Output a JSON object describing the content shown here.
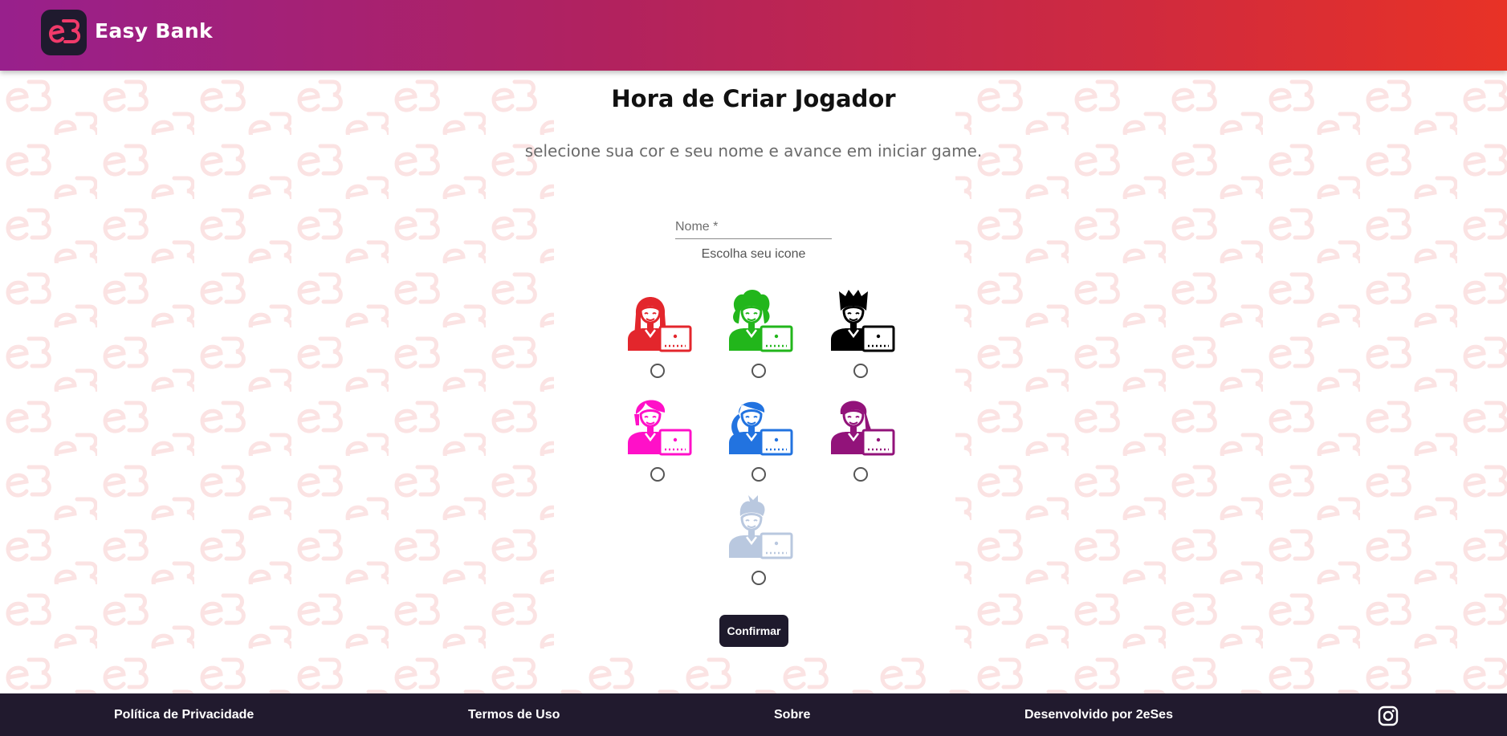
{
  "header": {
    "brand": "Easy Bank",
    "logo_icon": "easy-bank-logo"
  },
  "main": {
    "title": "Hora de Criar Jogador",
    "subtitle": "selecione sua cor e seu nome e avance em iniciar game.",
    "name_placeholder": "Nome *",
    "name_value": "",
    "choose_icon_label": "Escolha seu icone",
    "avatars": [
      {
        "color": "#e3262c",
        "style": "woman-long-hair",
        "selected": false
      },
      {
        "color": "#22b61b",
        "style": "woman-curly-hair",
        "selected": false
      },
      {
        "color": "#000000",
        "style": "man-spiky-hair",
        "selected": false
      },
      {
        "color": "#ff10c8",
        "style": "woman-pink-hair",
        "selected": false
      },
      {
        "color": "#2273e0",
        "style": "woman-ponytail",
        "selected": false
      },
      {
        "color": "#92137a",
        "style": "woman-side-hair",
        "selected": false
      },
      {
        "color": "#b9c8df",
        "style": "man-quiff",
        "selected": false
      }
    ],
    "confirm_label": "Confirmar"
  },
  "footer": {
    "links": [
      "Política de Privacidade",
      "Termos de Uso",
      "Sobre",
      "Desenvolvido por 2eSes"
    ],
    "social_icon": "instagram-icon"
  },
  "colors": {
    "header_start": "#98208c",
    "header_end": "#e83226",
    "footer_bg": "#211a2e",
    "button_bg": "#1e1a2c",
    "pattern": "#fbe3e3"
  }
}
